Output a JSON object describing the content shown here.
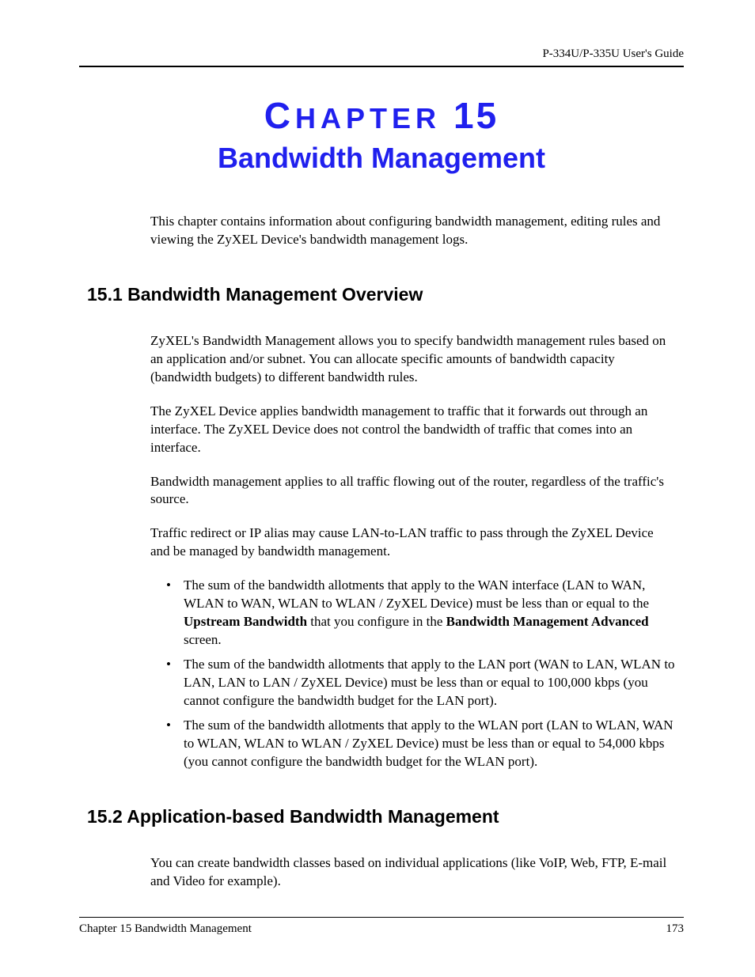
{
  "header": {
    "guide_title": "P-334U/P-335U User's Guide"
  },
  "chapter": {
    "label_prefix": "C",
    "label_rest": "HAPTER",
    "number": "15",
    "title": "Bandwidth Management",
    "intro": "This chapter contains information about configuring bandwidth management, editing rules and viewing the ZyXEL Device's bandwidth management logs."
  },
  "section1": {
    "heading": "15.1  Bandwidth Management Overview",
    "p1": "ZyXEL's Bandwidth Management allows you to specify bandwidth management rules based on an application and/or subnet. You can allocate specific amounts of bandwidth capacity (bandwidth budgets) to different bandwidth rules.",
    "p2": "The ZyXEL Device applies bandwidth management to traffic that it forwards out through an interface. The ZyXEL Device does not control the bandwidth of traffic that comes into an interface.",
    "p3": "Bandwidth management applies to all traffic flowing out of the router, regardless of the traffic's source.",
    "p4": "Traffic redirect or IP alias may cause LAN-to-LAN traffic to pass through the ZyXEL Device and be managed by bandwidth management.",
    "bullets": {
      "b1_pre": "The sum of the bandwidth allotments that apply to the WAN interface (LAN to WAN, WLAN to WAN, WLAN to WLAN / ZyXEL Device) must be less than or equal to the ",
      "b1_bold1": "Upstream Bandwidth",
      "b1_mid": " that you configure in the ",
      "b1_bold2": "Bandwidth Management Advanced",
      "b1_post": " screen.",
      "b2": "The sum of the bandwidth allotments that apply to the LAN port (WAN to LAN, WLAN to LAN, LAN to LAN / ZyXEL Device) must be less than or equal to 100,000 kbps (you cannot configure the bandwidth budget for the LAN port).",
      "b3": "The sum of the bandwidth allotments that apply to the WLAN port (LAN to WLAN, WAN to WLAN, WLAN to WLAN / ZyXEL Device) must be less than or equal to 54,000 kbps (you cannot configure the bandwidth budget for the WLAN port)."
    }
  },
  "section2": {
    "heading": "15.2  Application-based Bandwidth Management",
    "p1": "You can create bandwidth classes based on individual applications (like VoIP, Web, FTP, E-mail and Video for example)."
  },
  "footer": {
    "left": "Chapter 15 Bandwidth Management",
    "right": "173"
  },
  "glyphs": {
    "bullet": "•"
  }
}
